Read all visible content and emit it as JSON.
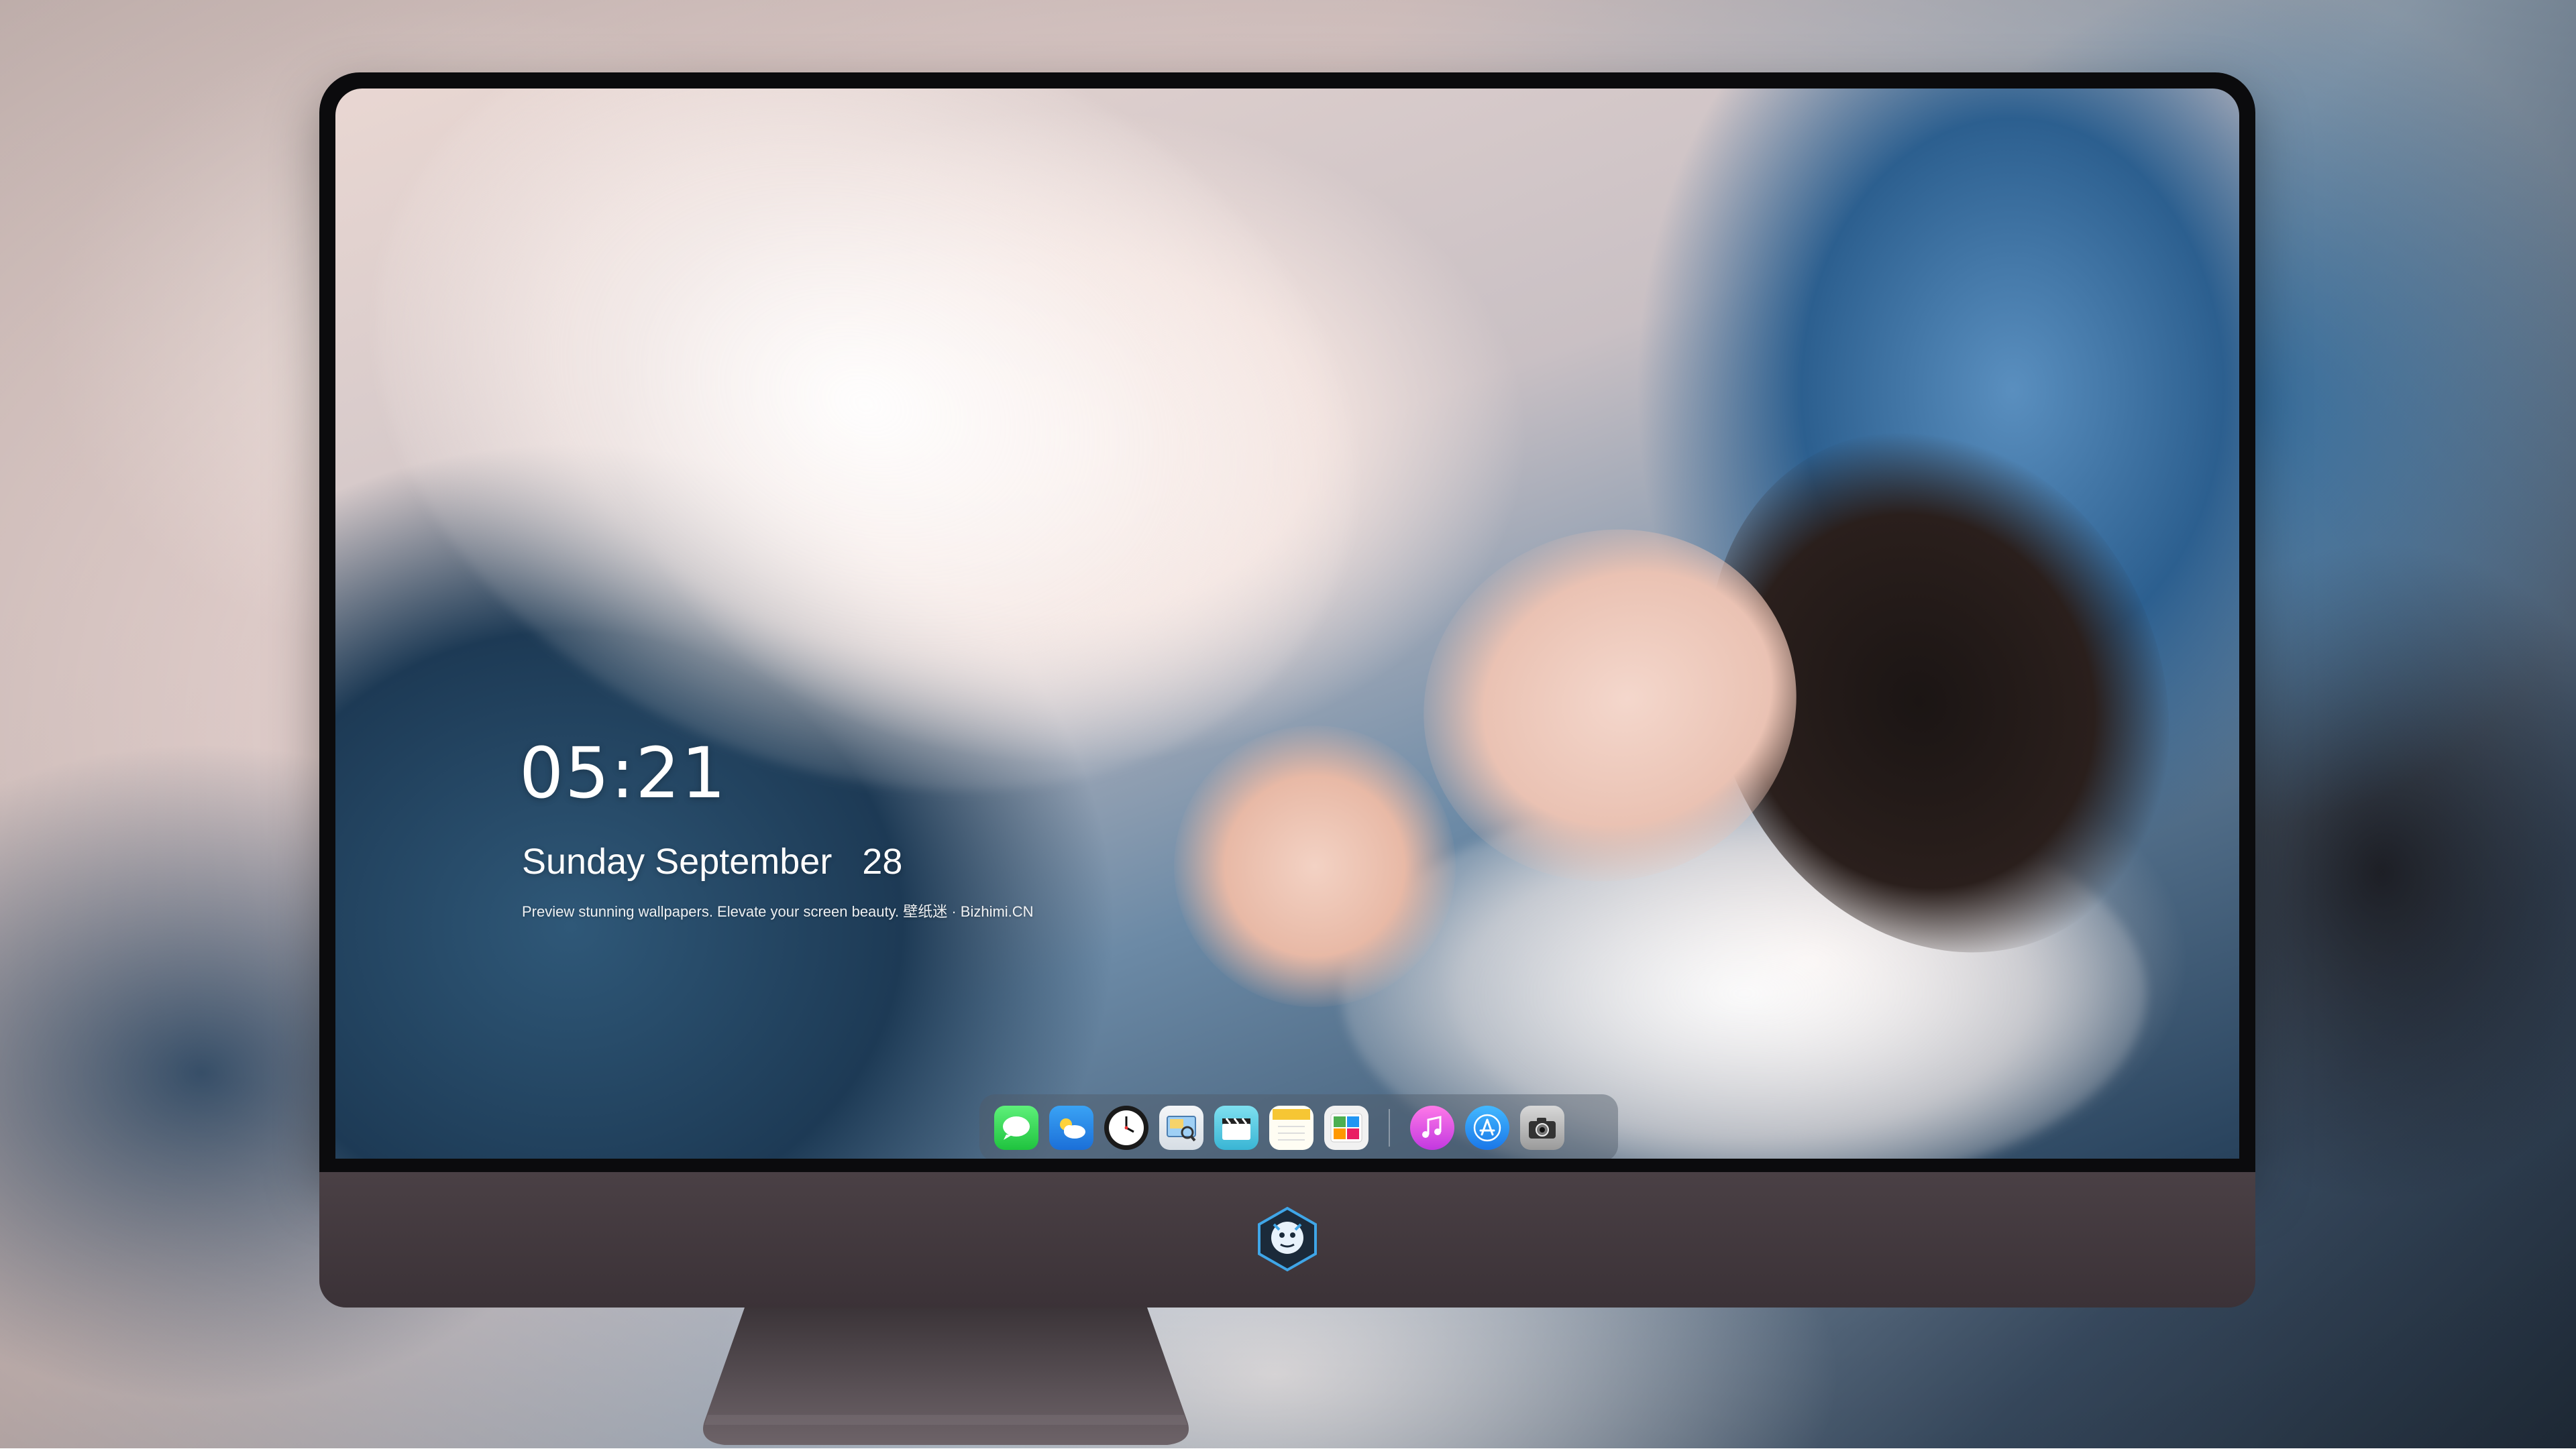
{
  "lockscreen": {
    "time": "05:21",
    "date": "Sunday September   28",
    "caption": "Preview stunning wallpapers. Elevate your screen beauty. 壁纸迷 · Bizhimi.CN"
  },
  "dock": {
    "items": [
      {
        "name": "messages-icon"
      },
      {
        "name": "weather-icon"
      },
      {
        "name": "clock-icon"
      },
      {
        "name": "preview-icon"
      },
      {
        "name": "video-icon"
      },
      {
        "name": "notes-icon"
      },
      {
        "name": "photos-icon"
      },
      {
        "name": "music-icon"
      },
      {
        "name": "app-store-icon"
      },
      {
        "name": "camera-icon"
      }
    ]
  },
  "colors": {
    "bezel": "#0b0b0d",
    "chin": "#3f353a",
    "dock": "#505a69",
    "accent_blue": "#2c5f8f"
  }
}
